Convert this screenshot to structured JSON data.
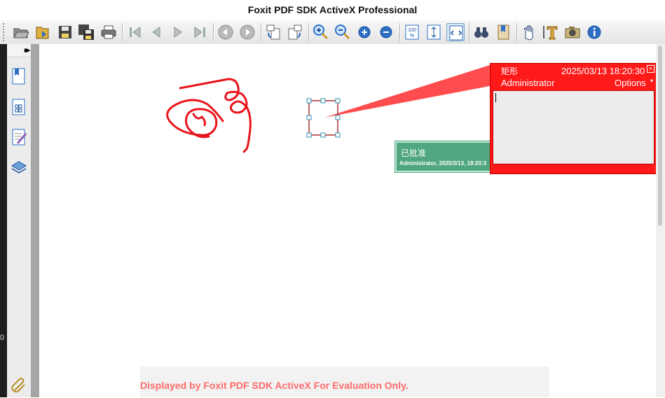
{
  "window": {
    "title": "Foxit PDF SDK ActiveX Professional"
  },
  "toolbar": {
    "buttons": [
      {
        "name": "open-file-button",
        "icon": "folder-open-icon"
      },
      {
        "name": "open-url-button",
        "icon": "folder-arrow-icon"
      },
      {
        "name": "save-button",
        "icon": "floppy-icon"
      },
      {
        "name": "save-as-button",
        "icon": "floppy-multi-icon"
      },
      {
        "name": "print-button",
        "icon": "printer-icon"
      },
      {
        "name": "first-page-button",
        "icon": "first-page-icon"
      },
      {
        "name": "previous-page-button",
        "icon": "previous-page-icon"
      },
      {
        "name": "next-page-button",
        "icon": "next-page-icon"
      },
      {
        "name": "last-page-button",
        "icon": "last-page-icon"
      },
      {
        "name": "back-button",
        "icon": "back-circle-icon"
      },
      {
        "name": "forward-button",
        "icon": "forward-circle-icon"
      },
      {
        "name": "rotate-left-button",
        "icon": "rotate-left-icon"
      },
      {
        "name": "rotate-right-button",
        "icon": "rotate-right-icon"
      },
      {
        "name": "zoom-in-tool-button",
        "icon": "zoom-in-magnifier-icon"
      },
      {
        "name": "zoom-out-tool-button",
        "icon": "zoom-out-magnifier-icon"
      },
      {
        "name": "zoom-in-button",
        "icon": "zoom-in-icon"
      },
      {
        "name": "zoom-out-button",
        "icon": "zoom-out-icon"
      },
      {
        "name": "actual-size-button",
        "icon": "actual-size-icon",
        "label": "100"
      },
      {
        "name": "fit-page-button",
        "icon": "fit-page-icon"
      },
      {
        "name": "fit-width-button",
        "icon": "fit-width-icon"
      },
      {
        "name": "find-button",
        "icon": "binoculars-icon"
      },
      {
        "name": "bookmark-button",
        "icon": "bookmark-icon"
      },
      {
        "name": "hand-tool-button",
        "icon": "hand-icon"
      },
      {
        "name": "text-select-button",
        "icon": "text-select-icon"
      },
      {
        "name": "snapshot-button",
        "icon": "camera-icon"
      },
      {
        "name": "about-button",
        "icon": "info-icon"
      }
    ]
  },
  "left_edge": {
    "number": "0"
  },
  "sidebar": {
    "expand_label": "▸▸",
    "items": [
      {
        "name": "sidebar-bookmarks",
        "icon": "bookmarks-panel-icon"
      },
      {
        "name": "sidebar-thumbnails",
        "icon": "thumbnails-panel-icon"
      },
      {
        "name": "sidebar-annotations",
        "icon": "annotations-panel-icon"
      },
      {
        "name": "sidebar-layers",
        "icon": "layers-panel-icon"
      },
      {
        "name": "sidebar-attachments",
        "icon": "paperclip-icon"
      }
    ]
  },
  "stamp": {
    "title": "已批准",
    "subtitle": "Administrator, 2025/3/13, 18:20:3"
  },
  "popup": {
    "title": "矩形",
    "date": "2025/03/13 18:20:30",
    "close": "×",
    "author": "Administrator",
    "options": "Options",
    "options_arrow": "▾",
    "body": ""
  },
  "evaluation": {
    "text": "Displayed by Foxit PDF SDK ActiveX For Evaluation Only."
  },
  "colors": {
    "ink": "#e8141b",
    "popup": "#ff1a1a",
    "stamp": "#4fa67f",
    "rect_annotation": "#b03030",
    "handle": "#2f8fb5",
    "watermark": "#ff6b6b"
  }
}
